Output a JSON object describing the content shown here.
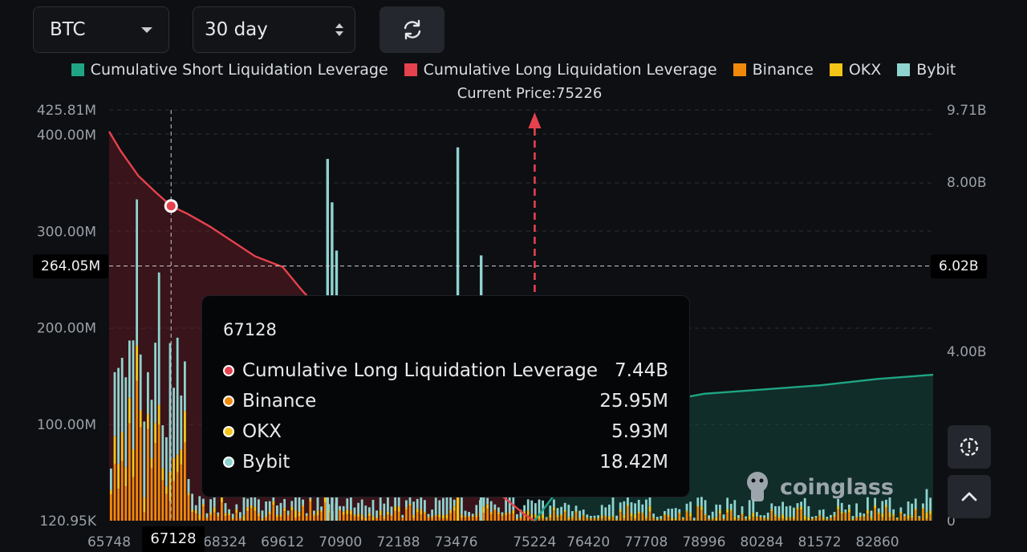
{
  "controls": {
    "coin": "BTC",
    "period": "30 day"
  },
  "legend": [
    {
      "label": "Cumulative Short Liquidation Leverage",
      "color": "#1fa584"
    },
    {
      "label": "Cumulative Long Liquidation Leverage",
      "color": "#e5424d"
    },
    {
      "label": "Binance",
      "color": "#f0890b"
    },
    {
      "label": "OKX",
      "color": "#f5c518"
    },
    {
      "label": "Bybit",
      "color": "#8fd3cf"
    }
  ],
  "current_price": {
    "label": "Current Price:",
    "value": "75226"
  },
  "crosshair": {
    "left_value": "264.05M",
    "right_value": "6.02B",
    "x_value": "67128"
  },
  "tooltip": {
    "title": "67128",
    "rows": [
      {
        "label": "Cumulative Long Liquidation Leverage",
        "value": "7.44B",
        "color": "#e5424d"
      },
      {
        "label": "Binance",
        "value": "25.95M",
        "color": "#f0890b"
      },
      {
        "label": "OKX",
        "value": "5.93M",
        "color": "#f5c518"
      },
      {
        "label": "Bybit",
        "value": "18.42M",
        "color": "#8fd3cf"
      }
    ]
  },
  "watermark": "coinglass",
  "chart_data": {
    "type": "bar",
    "x_ticks": [
      "65748",
      "67128",
      "68324",
      "69612",
      "70900",
      "72188",
      "73476",
      "75224",
      "76420",
      "77708",
      "78996",
      "80284",
      "81572",
      "82860"
    ],
    "x_range": [
      65748,
      84100
    ],
    "left_axis": {
      "ticks": [
        "120.95K",
        "100.00M",
        "200.00M",
        "300.00M",
        "400.00M",
        "425.81M"
      ],
      "range": [
        0,
        425810000
      ]
    },
    "right_axis": {
      "ticks": [
        "0",
        "4.00B",
        "8.00B",
        "9.71B"
      ],
      "range": [
        0,
        9710000000
      ]
    },
    "current_price": 75226,
    "long_cumulative": {
      "name": "Cumulative Long Liquidation Leverage",
      "x": [
        65748,
        66000,
        66400,
        66800,
        67128,
        67500,
        68000,
        68500,
        69000,
        69612,
        70000,
        70500,
        71000,
        71500,
        72000,
        72500,
        73000,
        73476,
        74000,
        74600,
        75000,
        75224
      ],
      "y": [
        9.2,
        8.75,
        8.15,
        7.75,
        7.44,
        7.25,
        6.95,
        6.6,
        6.25,
        6.0,
        5.5,
        4.9,
        4.35,
        3.8,
        3.2,
        2.6,
        2.0,
        1.5,
        1.0,
        0.5,
        0.15,
        0.0
      ]
    },
    "short_cumulative": {
      "name": "Cumulative Short Liquidation Leverage",
      "x": [
        75224,
        75800,
        76420,
        77000,
        77708,
        78500,
        78996,
        80284,
        81572,
        82860,
        84100
      ],
      "y": [
        0.0,
        0.8,
        1.3,
        1.9,
        2.6,
        2.9,
        3.0,
        3.1,
        3.2,
        3.35,
        3.45
      ]
    },
    "tall_bars": [
      {
        "x": 70610,
        "binance": 0,
        "okx": 0,
        "bybit": 375000000
      },
      {
        "x": 70710,
        "binance": 0,
        "okx": 0,
        "bybit": 330000000
      },
      {
        "x": 70810,
        "binance": 0,
        "okx": 0,
        "bybit": 280000000
      },
      {
        "x": 73510,
        "binance": 0,
        "okx": 25000000,
        "bybit": 362000000
      },
      {
        "x": 74030,
        "binance": 0,
        "okx": 0,
        "bybit": 275000000
      }
    ]
  }
}
